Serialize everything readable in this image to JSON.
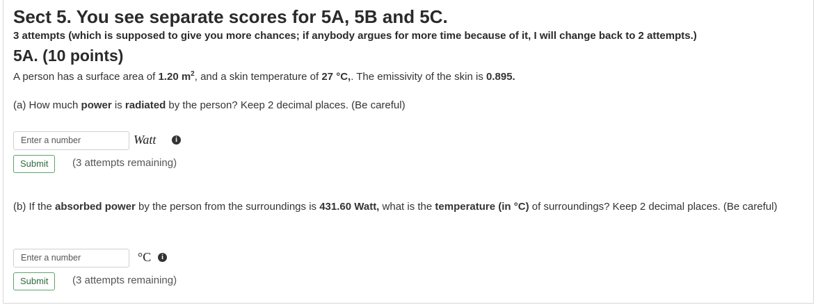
{
  "header": {
    "title": "Sect 5. You see separate scores for 5A, 5B and 5C.",
    "attempts_note": "3 attempts (which is supposed to give you more chances; if anybody argues for more time because of it, I will change back to 2 attempts.)",
    "part_title": "5A. (10 points)"
  },
  "problem": {
    "intro_1": "A person has a surface area of ",
    "area": "1.20 m",
    "area_sup": "2",
    "intro_2": ", and a  skin temperature of ",
    "temp": "27 °C,",
    "intro_3": ". The emissivity of the skin is ",
    "emissivity": "0.895."
  },
  "part_a": {
    "q_1": "(a)  How much ",
    "q_power": "power",
    "q_2": " is ",
    "q_radiated": "radiated",
    "q_3": " by the person?  Keep 2 decimal places. (Be careful)",
    "input_placeholder": "Enter a number",
    "unit": "Watt",
    "submit_label": "Submit",
    "attempts_remaining": "(3 attempts remaining)"
  },
  "part_b": {
    "q_1": "(b) If the ",
    "q_absorbed": "absorbed power",
    "q_2": " by the person from the surroundings is ",
    "q_value": "431.60 Watt,",
    "q_3": " what is the  ",
    "q_temp": "temperature (in °C)",
    "q_4": "  of  surroundings? Keep 2 decimal places.   (Be careful)",
    "input_placeholder": "Enter a number",
    "unit": "°C",
    "submit_label": "Submit",
    "attempts_remaining": "(3 attempts remaining)"
  },
  "icons": {
    "info": "info-icon"
  },
  "colors": {
    "submit_border": "#5aa469",
    "submit_text": "#2e6b3a"
  }
}
